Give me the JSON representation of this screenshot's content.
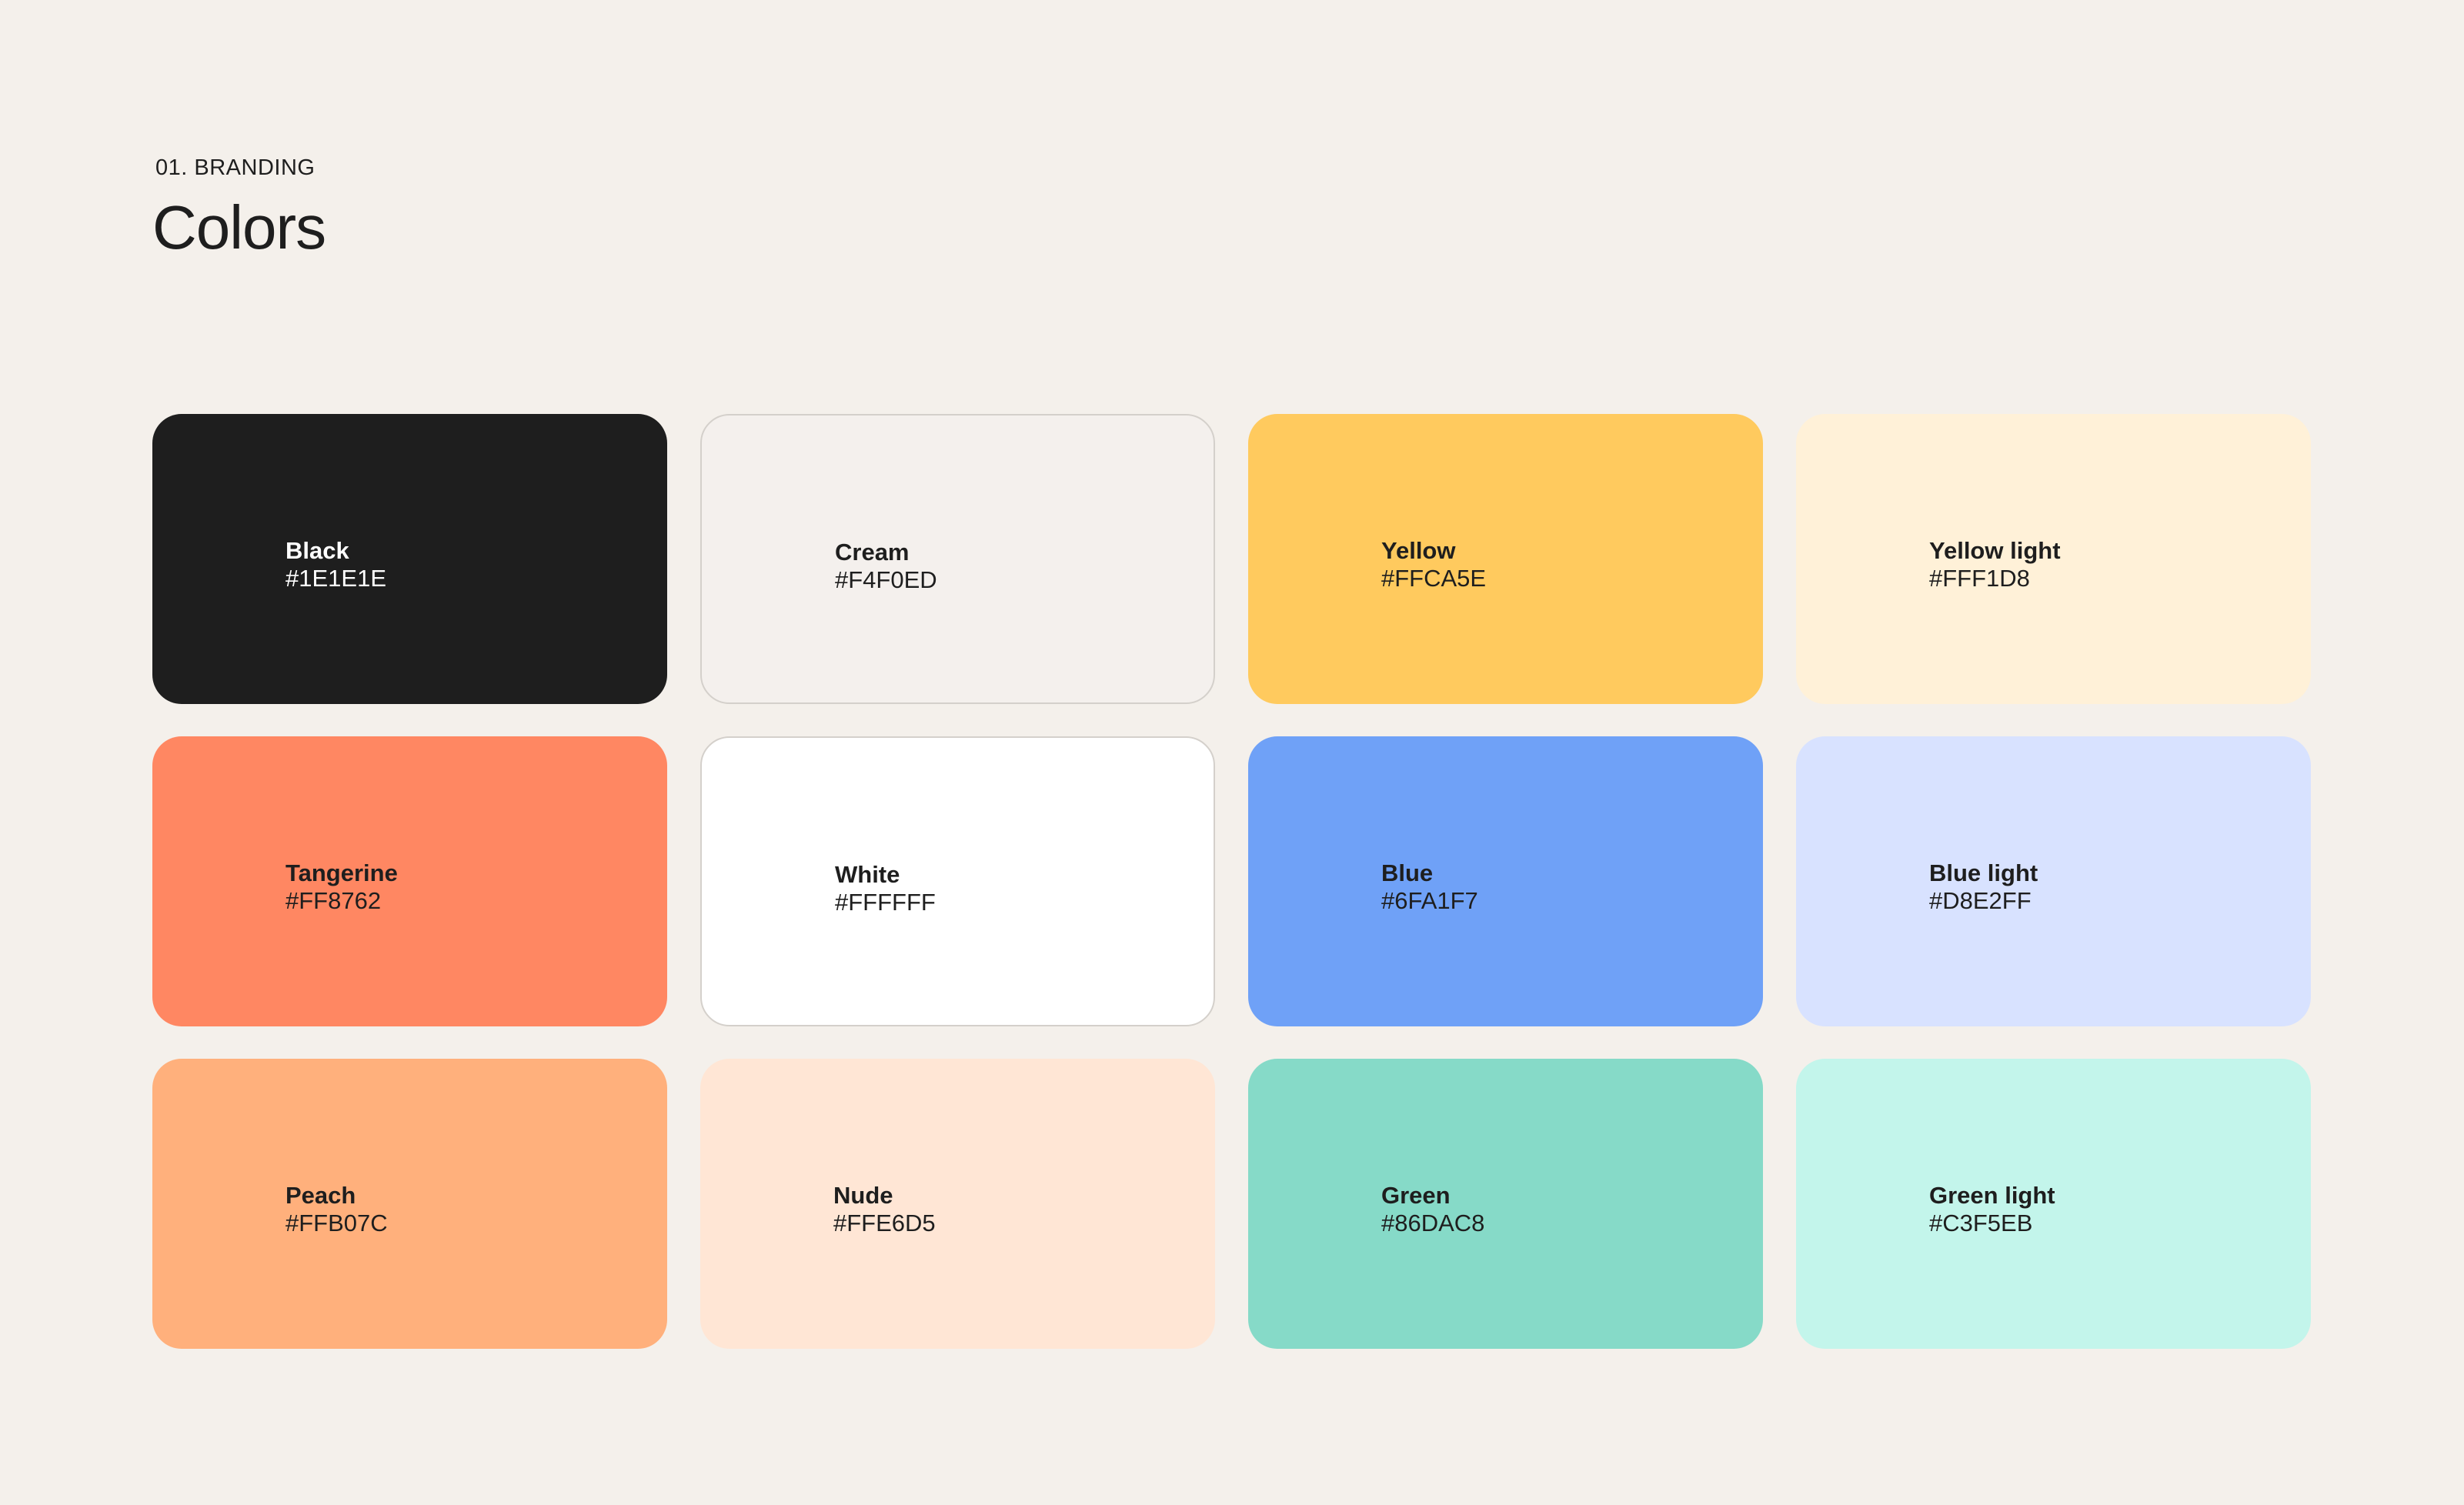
{
  "header": {
    "section_label": "01. BRANDING",
    "title": "Colors"
  },
  "swatches": [
    {
      "name": "Black",
      "hex": "#1E1E1E",
      "color": "#1E1E1E",
      "text_color": "#FFFFFF",
      "outlined": false
    },
    {
      "name": "Cream",
      "hex": "#F4F0ED",
      "color": "#F4F0ED",
      "text_color": "#1E1E1E",
      "outlined": true
    },
    {
      "name": "Yellow",
      "hex": "#FFCA5E",
      "color": "#FFCA5E",
      "text_color": "#1E1E1E",
      "outlined": false
    },
    {
      "name": "Yellow light",
      "hex": "#FFF1D8",
      "color": "#FFF1D8",
      "text_color": "#1E1E1E",
      "outlined": false
    },
    {
      "name": "Tangerine",
      "hex": "#FF8762",
      "color": "#FF8762",
      "text_color": "#1E1E1E",
      "outlined": false
    },
    {
      "name": "White",
      "hex": "#FFFFFF",
      "color": "#FFFFFF",
      "text_color": "#1E1E1E",
      "outlined": true
    },
    {
      "name": "Blue",
      "hex": "#6FA1F7",
      "color": "#6FA1F7",
      "text_color": "#1E1E1E",
      "outlined": false
    },
    {
      "name": "Blue light",
      "hex": "#D8E2FF",
      "color": "#D8E2FF",
      "text_color": "#1E1E1E",
      "outlined": false
    },
    {
      "name": "Peach",
      "hex": "#FFB07C",
      "color": "#FFB07C",
      "text_color": "#1E1E1E",
      "outlined": false
    },
    {
      "name": "Nude",
      "hex": "#FFE6D5",
      "color": "#FFE6D5",
      "text_color": "#1E1E1E",
      "outlined": false
    },
    {
      "name": "Green",
      "hex": "#86DAC8",
      "color": "#86DAC8",
      "text_color": "#1E1E1E",
      "outlined": false
    },
    {
      "name": "Green light",
      "hex": "#C3F5EB",
      "color": "#C3F5EB",
      "text_color": "#1E1E1E",
      "outlined": false
    }
  ]
}
